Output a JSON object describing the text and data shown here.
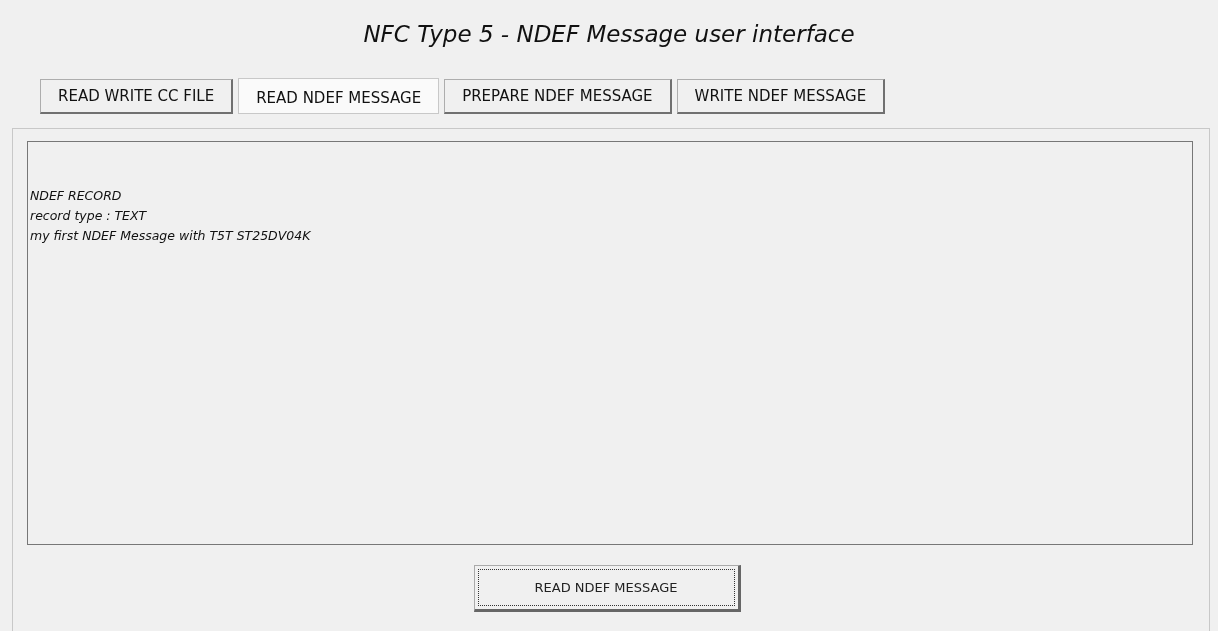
{
  "title": "NFC Type 5 - NDEF Message user interface",
  "tabs": [
    {
      "label": "READ WRITE CC FILE",
      "selected": false
    },
    {
      "label": "READ NDEF MESSAGE",
      "selected": true
    },
    {
      "label": "PREPARE NDEF MESSAGE",
      "selected": false
    },
    {
      "label": "WRITE NDEF MESSAGE",
      "selected": false
    }
  ],
  "output": {
    "lines": [
      "NDEF RECORD",
      "record type : TEXT",
      "my first NDEF Message with T5T ST25DV04K"
    ]
  },
  "action_button": {
    "label": "READ NDEF MESSAGE",
    "focused": true
  }
}
